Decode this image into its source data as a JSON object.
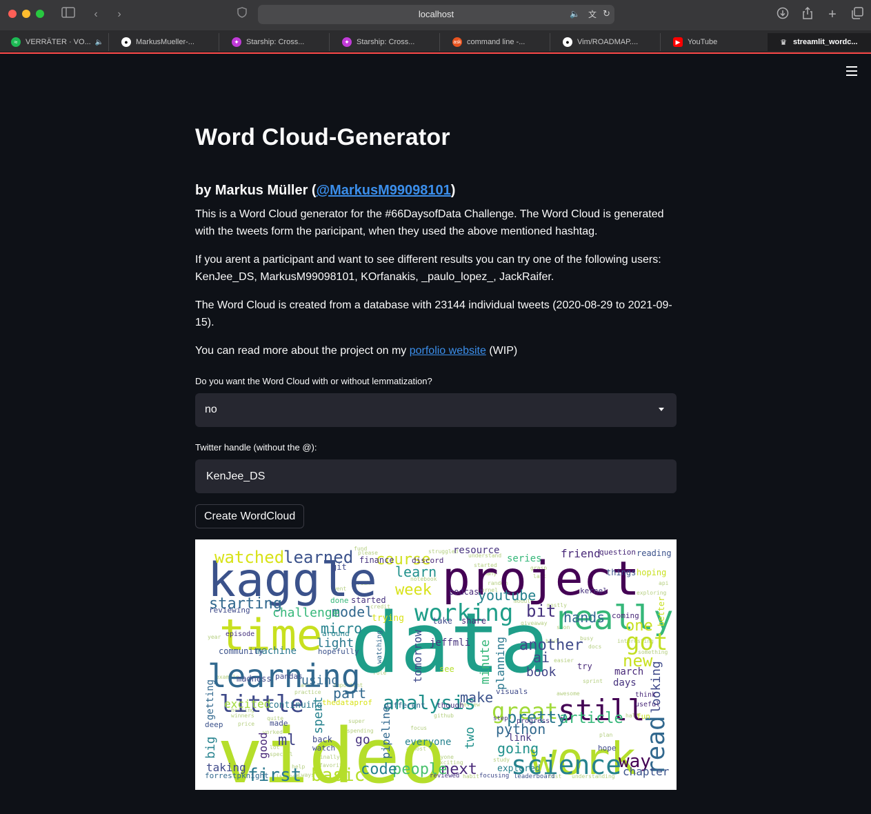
{
  "browser": {
    "url": "localhost",
    "tabs": [
      {
        "label": "VERRÄTER · VO...",
        "icon": "spotify-icon",
        "color": "#1db954"
      },
      {
        "label": "MarkusMueller-...",
        "icon": "github-icon",
        "color": "#ffffff"
      },
      {
        "label": "Starship: Cross...",
        "icon": "starship-icon",
        "color": "#c13bd8"
      },
      {
        "label": "Starship: Cross...",
        "icon": "starship-icon",
        "color": "#c13bd8"
      },
      {
        "label": "command line -...",
        "icon": "askubuntu-icon",
        "color": "#e95420"
      },
      {
        "label": "Vim/ROADMAP....",
        "icon": "github-icon",
        "color": "#ffffff"
      },
      {
        "label": "YouTube",
        "icon": "youtube-icon",
        "color": "#ff0000"
      },
      {
        "label": "streamlit_wordc...",
        "icon": "streamlit-icon",
        "color": "#ffffff"
      }
    ]
  },
  "page": {
    "title": "Word Cloud-Generator",
    "author_prefix": "by Markus Müller (",
    "author_handle": "@MarkusM99098101",
    "author_suffix": ")",
    "para1": "This is a Word Cloud generator for the #66DaysofData Challenge. The Word Cloud is generated with the tweets form the paricipant, when they used the above mentioned hashtag.",
    "para2": "If you arent a participant and want to see different results you can try one of the following users: KenJee_DS, MarkusM99098101, KOrfanakis, _paulo_lopez_, JackRaifer.",
    "para3": "The Word Cloud is created from a database with 23144 individual tweets (2020-08-29 to 2021-09-15).",
    "para4_prefix": "You can read more about the project on my ",
    "para4_link": "porfolio website",
    "para4_suffix": " (WIP)",
    "lemma_label": "Do you want the Word Cloud with or without lemmatization?",
    "lemma_value": "no",
    "handle_label": "Twitter handle (without the @):",
    "handle_value": "KenJee_DS",
    "button_label": "Create WordCloud"
  },
  "wordcloud": {
    "words": [
      {
        "t": "data",
        "c": "#1f9e89"
      },
      {
        "t": "video",
        "c": "#b5de2b"
      },
      {
        "t": "kaggle",
        "c": "#3b528b"
      },
      {
        "t": "project",
        "c": "#440154"
      },
      {
        "t": "time",
        "c": "#c8e020"
      },
      {
        "t": "learning",
        "c": "#31688e"
      },
      {
        "t": "really",
        "c": "#35b779"
      },
      {
        "t": "work",
        "c": "#b5de2b"
      },
      {
        "t": "science",
        "c": "#26828e"
      },
      {
        "t": "still",
        "c": "#440154"
      },
      {
        "t": "little",
        "c": "#3e4989"
      },
      {
        "t": "working",
        "c": "#1f9e89"
      },
      {
        "t": "analysis",
        "c": "#21918c"
      },
      {
        "t": "great",
        "c": "#a0da39"
      },
      {
        "t": "read",
        "c": "#31688e"
      },
      {
        "t": "watched",
        "c": "#d8e219"
      },
      {
        "t": "learned",
        "c": "#3b528b"
      },
      {
        "t": "course",
        "c": "#d0e11c"
      },
      {
        "t": "first",
        "c": "#2a788e"
      },
      {
        "t": "basic",
        "c": "#b5de2b"
      },
      {
        "t": "starting",
        "c": "#31688e"
      },
      {
        "t": "youtube",
        "c": "#26828e"
      },
      {
        "t": "got",
        "c": "#c2df23"
      },
      {
        "t": "another",
        "c": "#3e4989"
      },
      {
        "t": "article",
        "c": "#35b779"
      },
      {
        "t": "pretty",
        "c": "#2a788e"
      },
      {
        "t": "way",
        "c": "#440154"
      },
      {
        "t": "next",
        "c": "#482878"
      },
      {
        "t": "people",
        "c": "#4ac16d"
      },
      {
        "t": "code",
        "c": "#26828e"
      },
      {
        "t": "python",
        "c": "#31688e"
      },
      {
        "t": "going",
        "c": "#21918c"
      },
      {
        "t": "model",
        "c": "#31688e"
      },
      {
        "t": "challenge",
        "c": "#35b779"
      },
      {
        "t": "week",
        "c": "#d8e219"
      },
      {
        "t": "learn",
        "c": "#21918c"
      },
      {
        "t": "bit",
        "c": "#46327e"
      },
      {
        "t": "hands",
        "c": "#31688e"
      },
      {
        "t": "one",
        "c": "#c8e020"
      },
      {
        "t": "new",
        "c": "#c8e020"
      },
      {
        "t": "micro",
        "c": "#26828e"
      },
      {
        "t": "light",
        "c": "#2a788e"
      },
      {
        "t": "ai",
        "c": "#3e4989"
      },
      {
        "t": "book",
        "c": "#414487"
      },
      {
        "t": "march",
        "c": "#482878"
      },
      {
        "t": "days",
        "c": "#46327e"
      },
      {
        "t": "part",
        "c": "#31688e"
      },
      {
        "t": "make",
        "c": "#3b528b"
      },
      {
        "t": "using",
        "c": "#31688e"
      },
      {
        "t": "excited",
        "c": "#a0da39"
      },
      {
        "t": "continuing",
        "c": "#2a788e"
      },
      {
        "t": "ml",
        "c": "#414487"
      },
      {
        "t": "go",
        "c": "#46327e"
      },
      {
        "t": "everyone",
        "c": "#26828e"
      },
      {
        "t": "taking",
        "c": "#3e4989"
      },
      {
        "t": "link",
        "c": "#46327e"
      },
      {
        "t": "explored",
        "c": "#26828e"
      },
      {
        "t": "chapter",
        "c": "#3b528b"
      },
      {
        "t": "friend",
        "c": "#482878"
      },
      {
        "t": "resource",
        "c": "#46327e"
      },
      {
        "t": "series",
        "c": "#35b779"
      },
      {
        "t": "reading",
        "c": "#3b528b"
      },
      {
        "t": "machine",
        "c": "#2a788e"
      },
      {
        "t": "community",
        "c": "#3b528b"
      },
      {
        "t": "madness",
        "c": "#3e4989"
      },
      {
        "t": "pandas",
        "c": "#3e4989"
      },
      {
        "t": "jeffmli",
        "c": "#46327e"
      },
      {
        "t": "tomorrow",
        "c": "#3e4989"
      },
      {
        "t": "minute",
        "c": "#35b779"
      },
      {
        "t": "planning",
        "c": "#2a788e"
      },
      {
        "t": "pipeline",
        "c": "#31688e"
      },
      {
        "t": "two",
        "c": "#21918c"
      },
      {
        "t": "spent",
        "c": "#26828e"
      },
      {
        "t": "good",
        "c": "#482878"
      },
      {
        "t": "big",
        "c": "#26828e"
      },
      {
        "t": "getting",
        "c": "#31688e"
      },
      {
        "t": "looking",
        "c": "#3e4989"
      },
      {
        "t": "hoping",
        "c": "#c8e020"
      },
      {
        "t": "things",
        "c": "#3b528b"
      },
      {
        "t": "question",
        "c": "#482878"
      },
      {
        "t": "finance",
        "c": "#46327e"
      },
      {
        "t": "discord",
        "c": "#482878"
      },
      {
        "t": "git",
        "c": "#3e4989"
      },
      {
        "t": "podcast",
        "c": "#482878"
      },
      {
        "t": "kernel",
        "c": "#46327e"
      },
      {
        "t": "coming",
        "c": "#482878"
      },
      {
        "t": "better",
        "c": "#c8e020"
      },
      {
        "t": "trying",
        "c": "#d8e219"
      },
      {
        "t": "started",
        "c": "#46327e"
      },
      {
        "t": "done",
        "c": "#35b779"
      },
      {
        "t": "take",
        "c": "#3e4989"
      },
      {
        "t": "share",
        "c": "#482878"
      },
      {
        "t": "reviewing",
        "c": "#3e4989"
      },
      {
        "t": "episode",
        "c": "#46327e"
      },
      {
        "t": "around",
        "c": "#26828e"
      },
      {
        "t": "hopefully",
        "c": "#3b528b"
      },
      {
        "t": "watching",
        "c": "#31688e"
      },
      {
        "t": "see",
        "c": "#b5de2b"
      },
      {
        "t": "try",
        "c": "#482878"
      },
      {
        "t": "visuals",
        "c": "#3e4989"
      },
      {
        "t": "thedataprof",
        "c": "#d8e219"
      },
      {
        "t": "different",
        "c": "#31688e"
      },
      {
        "t": "though",
        "c": "#46327e"
      },
      {
        "t": "deep",
        "c": "#3b528b"
      },
      {
        "t": "made",
        "c": "#3e4989"
      },
      {
        "t": "back",
        "c": "#3e4989"
      },
      {
        "t": "watch",
        "c": "#3e4989"
      },
      {
        "t": "progress",
        "c": "#46327e"
      },
      {
        "t": "think",
        "c": "#482878"
      },
      {
        "t": "useful",
        "c": "#482878"
      },
      {
        "t": "fun",
        "c": "#c8e020"
      },
      {
        "t": "hope",
        "c": "#3e4989"
      },
      {
        "t": "forrestpknight",
        "c": "#31688e"
      },
      {
        "t": "reviewed",
        "c": "#46327e"
      },
      {
        "t": "focusing",
        "c": "#3e4989"
      },
      {
        "t": "leaderboard",
        "c": "#3b528b"
      },
      {
        "t": "step",
        "c": "#46327e"
      }
    ]
  }
}
